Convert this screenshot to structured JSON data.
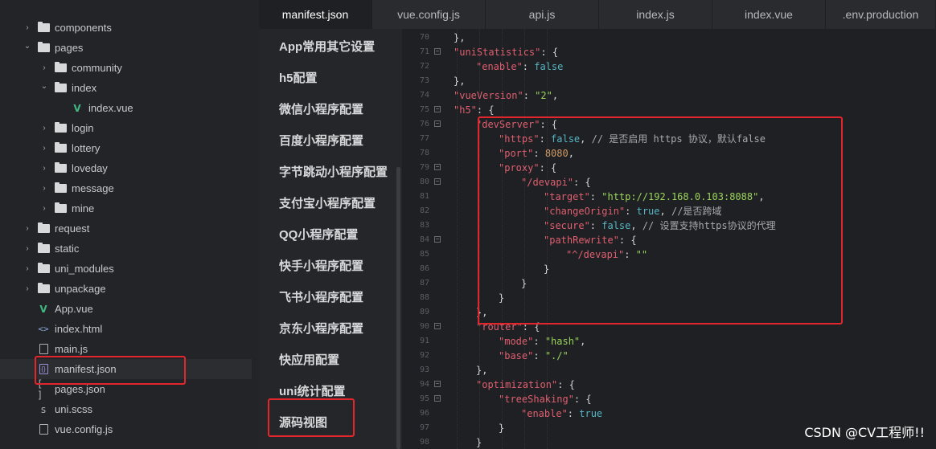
{
  "explorer": {
    "items": [
      {
        "label": "components",
        "type": "folder",
        "expanded": false
      },
      {
        "label": "pages",
        "type": "folder",
        "expanded": true
      },
      {
        "label": "community",
        "type": "folder",
        "expanded": false
      },
      {
        "label": "index",
        "type": "folder",
        "expanded": true
      },
      {
        "label": "index.vue",
        "type": "vue"
      },
      {
        "label": "login",
        "type": "folder",
        "expanded": false
      },
      {
        "label": "lottery",
        "type": "folder",
        "expanded": false
      },
      {
        "label": "loveday",
        "type": "folder",
        "expanded": false
      },
      {
        "label": "message",
        "type": "folder",
        "expanded": false
      },
      {
        "label": "mine",
        "type": "folder",
        "expanded": false
      },
      {
        "label": "request",
        "type": "folder",
        "expanded": false
      },
      {
        "label": "static",
        "type": "folder",
        "expanded": false
      },
      {
        "label": "uni_modules",
        "type": "folder",
        "expanded": false
      },
      {
        "label": "unpackage",
        "type": "folder",
        "expanded": false
      },
      {
        "label": "App.vue",
        "type": "vue"
      },
      {
        "label": "index.html",
        "type": "html"
      },
      {
        "label": "main.js",
        "type": "js"
      },
      {
        "label": "manifest.json",
        "type": "json",
        "selected": true
      },
      {
        "label": "pages.json",
        "type": "bracket"
      },
      {
        "label": "uni.scss",
        "type": "scss"
      },
      {
        "label": "vue.config.js",
        "type": "js"
      }
    ]
  },
  "tabs": [
    {
      "label": "manifest.json",
      "active": true
    },
    {
      "label": "vue.config.js"
    },
    {
      "label": "api.js"
    },
    {
      "label": "index.js"
    },
    {
      "label": "index.vue"
    },
    {
      "label": ".env.production"
    }
  ],
  "config_nav": [
    "App常用其它设置",
    "h5配置",
    "微信小程序配置",
    "百度小程序配置",
    "字节跳动小程序配置",
    "支付宝小程序配置",
    "QQ小程序配置",
    "快手小程序配置",
    "飞书小程序配置",
    "京东小程序配置",
    "快应用配置",
    "uni统计配置",
    "源码视图"
  ],
  "code": [
    {
      "ln": "70",
      "fold": false,
      "indent": 2,
      "tokens": [
        [
          "p",
          "},"
        ]
      ]
    },
    {
      "ln": "71",
      "fold": true,
      "indent": 2,
      "tokens": [
        [
          "k",
          "\"uniStatistics\""
        ],
        [
          "p",
          ": {"
        ]
      ]
    },
    {
      "ln": "72",
      "fold": false,
      "indent": 3,
      "tokens": [
        [
          "k",
          "\"enable\""
        ],
        [
          "p",
          ": "
        ],
        [
          "b",
          "false"
        ]
      ]
    },
    {
      "ln": "73",
      "fold": false,
      "indent": 2,
      "tokens": [
        [
          "p",
          "},"
        ]
      ]
    },
    {
      "ln": "74",
      "fold": false,
      "indent": 2,
      "tokens": [
        [
          "k",
          "\"vueVersion\""
        ],
        [
          "p",
          ": "
        ],
        [
          "s",
          "\"2\""
        ],
        [
          "p",
          ","
        ]
      ]
    },
    {
      "ln": "75",
      "fold": true,
      "indent": 2,
      "tokens": [
        [
          "k",
          "\"h5\""
        ],
        [
          "p",
          ": {"
        ]
      ]
    },
    {
      "ln": "76",
      "fold": true,
      "indent": 3,
      "tokens": [
        [
          "k",
          "\"devServer\""
        ],
        [
          "p",
          ": {"
        ]
      ]
    },
    {
      "ln": "77",
      "fold": false,
      "indent": 4,
      "tokens": [
        [
          "k",
          "\"https\""
        ],
        [
          "p",
          ": "
        ],
        [
          "b",
          "false"
        ],
        [
          "p",
          ", "
        ],
        [
          "c",
          "// 是否启用 https 协议，默认false"
        ]
      ]
    },
    {
      "ln": "78",
      "fold": false,
      "indent": 4,
      "tokens": [
        [
          "k",
          "\"port\""
        ],
        [
          "p",
          ": "
        ],
        [
          "n",
          "8080"
        ],
        [
          "p",
          ","
        ]
      ]
    },
    {
      "ln": "79",
      "fold": true,
      "indent": 4,
      "tokens": [
        [
          "k",
          "\"proxy\""
        ],
        [
          "p",
          ": {"
        ]
      ]
    },
    {
      "ln": "80",
      "fold": true,
      "indent": 5,
      "tokens": [
        [
          "k",
          "\"/devapi\""
        ],
        [
          "p",
          ": {"
        ]
      ]
    },
    {
      "ln": "81",
      "fold": false,
      "indent": 6,
      "tokens": [
        [
          "k",
          "\"target\""
        ],
        [
          "p",
          ": "
        ],
        [
          "s",
          "\"http://192.168.0.103:8088\""
        ],
        [
          "p",
          ","
        ]
      ]
    },
    {
      "ln": "82",
      "fold": false,
      "indent": 6,
      "tokens": [
        [
          "k",
          "\"changeOrigin\""
        ],
        [
          "p",
          ": "
        ],
        [
          "b",
          "true"
        ],
        [
          "p",
          ", "
        ],
        [
          "c",
          "//是否跨域"
        ]
      ]
    },
    {
      "ln": "83",
      "fold": false,
      "indent": 6,
      "tokens": [
        [
          "k",
          "\"secure\""
        ],
        [
          "p",
          ": "
        ],
        [
          "b",
          "false"
        ],
        [
          "p",
          ", "
        ],
        [
          "c",
          "// 设置支持https协议的代理"
        ]
      ]
    },
    {
      "ln": "84",
      "fold": true,
      "indent": 6,
      "tokens": [
        [
          "k",
          "\"pathRewrite\""
        ],
        [
          "p",
          ": {"
        ]
      ]
    },
    {
      "ln": "85",
      "fold": false,
      "indent": 7,
      "tokens": [
        [
          "k",
          "\"^/devapi\""
        ],
        [
          "p",
          ": "
        ],
        [
          "s",
          "\"\""
        ]
      ]
    },
    {
      "ln": "86",
      "fold": false,
      "indent": 6,
      "tokens": [
        [
          "p",
          "}"
        ]
      ]
    },
    {
      "ln": "87",
      "fold": false,
      "indent": 5,
      "tokens": [
        [
          "p",
          "}"
        ]
      ]
    },
    {
      "ln": "88",
      "fold": false,
      "indent": 4,
      "tokens": [
        [
          "p",
          "}"
        ]
      ]
    },
    {
      "ln": "89",
      "fold": false,
      "indent": 3,
      "tokens": [
        [
          "p",
          "},"
        ]
      ]
    },
    {
      "ln": "90",
      "fold": true,
      "indent": 3,
      "tokens": [
        [
          "k",
          "\"router\""
        ],
        [
          "p",
          ": {"
        ]
      ]
    },
    {
      "ln": "91",
      "fold": false,
      "indent": 4,
      "tokens": [
        [
          "k",
          "\"mode\""
        ],
        [
          "p",
          ": "
        ],
        [
          "s",
          "\"hash\""
        ],
        [
          "p",
          ","
        ]
      ]
    },
    {
      "ln": "92",
      "fold": false,
      "indent": 4,
      "tokens": [
        [
          "k",
          "\"base\""
        ],
        [
          "p",
          ": "
        ],
        [
          "s",
          "\"./\""
        ]
      ]
    },
    {
      "ln": "93",
      "fold": false,
      "indent": 3,
      "tokens": [
        [
          "p",
          "},"
        ]
      ]
    },
    {
      "ln": "94",
      "fold": true,
      "indent": 3,
      "tokens": [
        [
          "k",
          "\"optimization\""
        ],
        [
          "p",
          ": {"
        ]
      ]
    },
    {
      "ln": "95",
      "fold": true,
      "indent": 4,
      "tokens": [
        [
          "k",
          "\"treeShaking\""
        ],
        [
          "p",
          ": {"
        ]
      ]
    },
    {
      "ln": "96",
      "fold": false,
      "indent": 5,
      "tokens": [
        [
          "k",
          "\"enable\""
        ],
        [
          "p",
          ": "
        ],
        [
          "b",
          "true"
        ]
      ]
    },
    {
      "ln": "97",
      "fold": false,
      "indent": 4,
      "tokens": [
        [
          "p",
          "}"
        ]
      ]
    },
    {
      "ln": "98",
      "fold": false,
      "indent": 3,
      "tokens": [
        [
          "p",
          "}"
        ]
      ]
    }
  ],
  "watermark": "CSDN @CV工程师!!",
  "colors": {
    "highlight": "#e3262c",
    "key": "#e05f6f",
    "string": "#9bd45a",
    "boolean": "#56b6c2",
    "number": "#d19a66",
    "comment": "#a8a9ad"
  }
}
